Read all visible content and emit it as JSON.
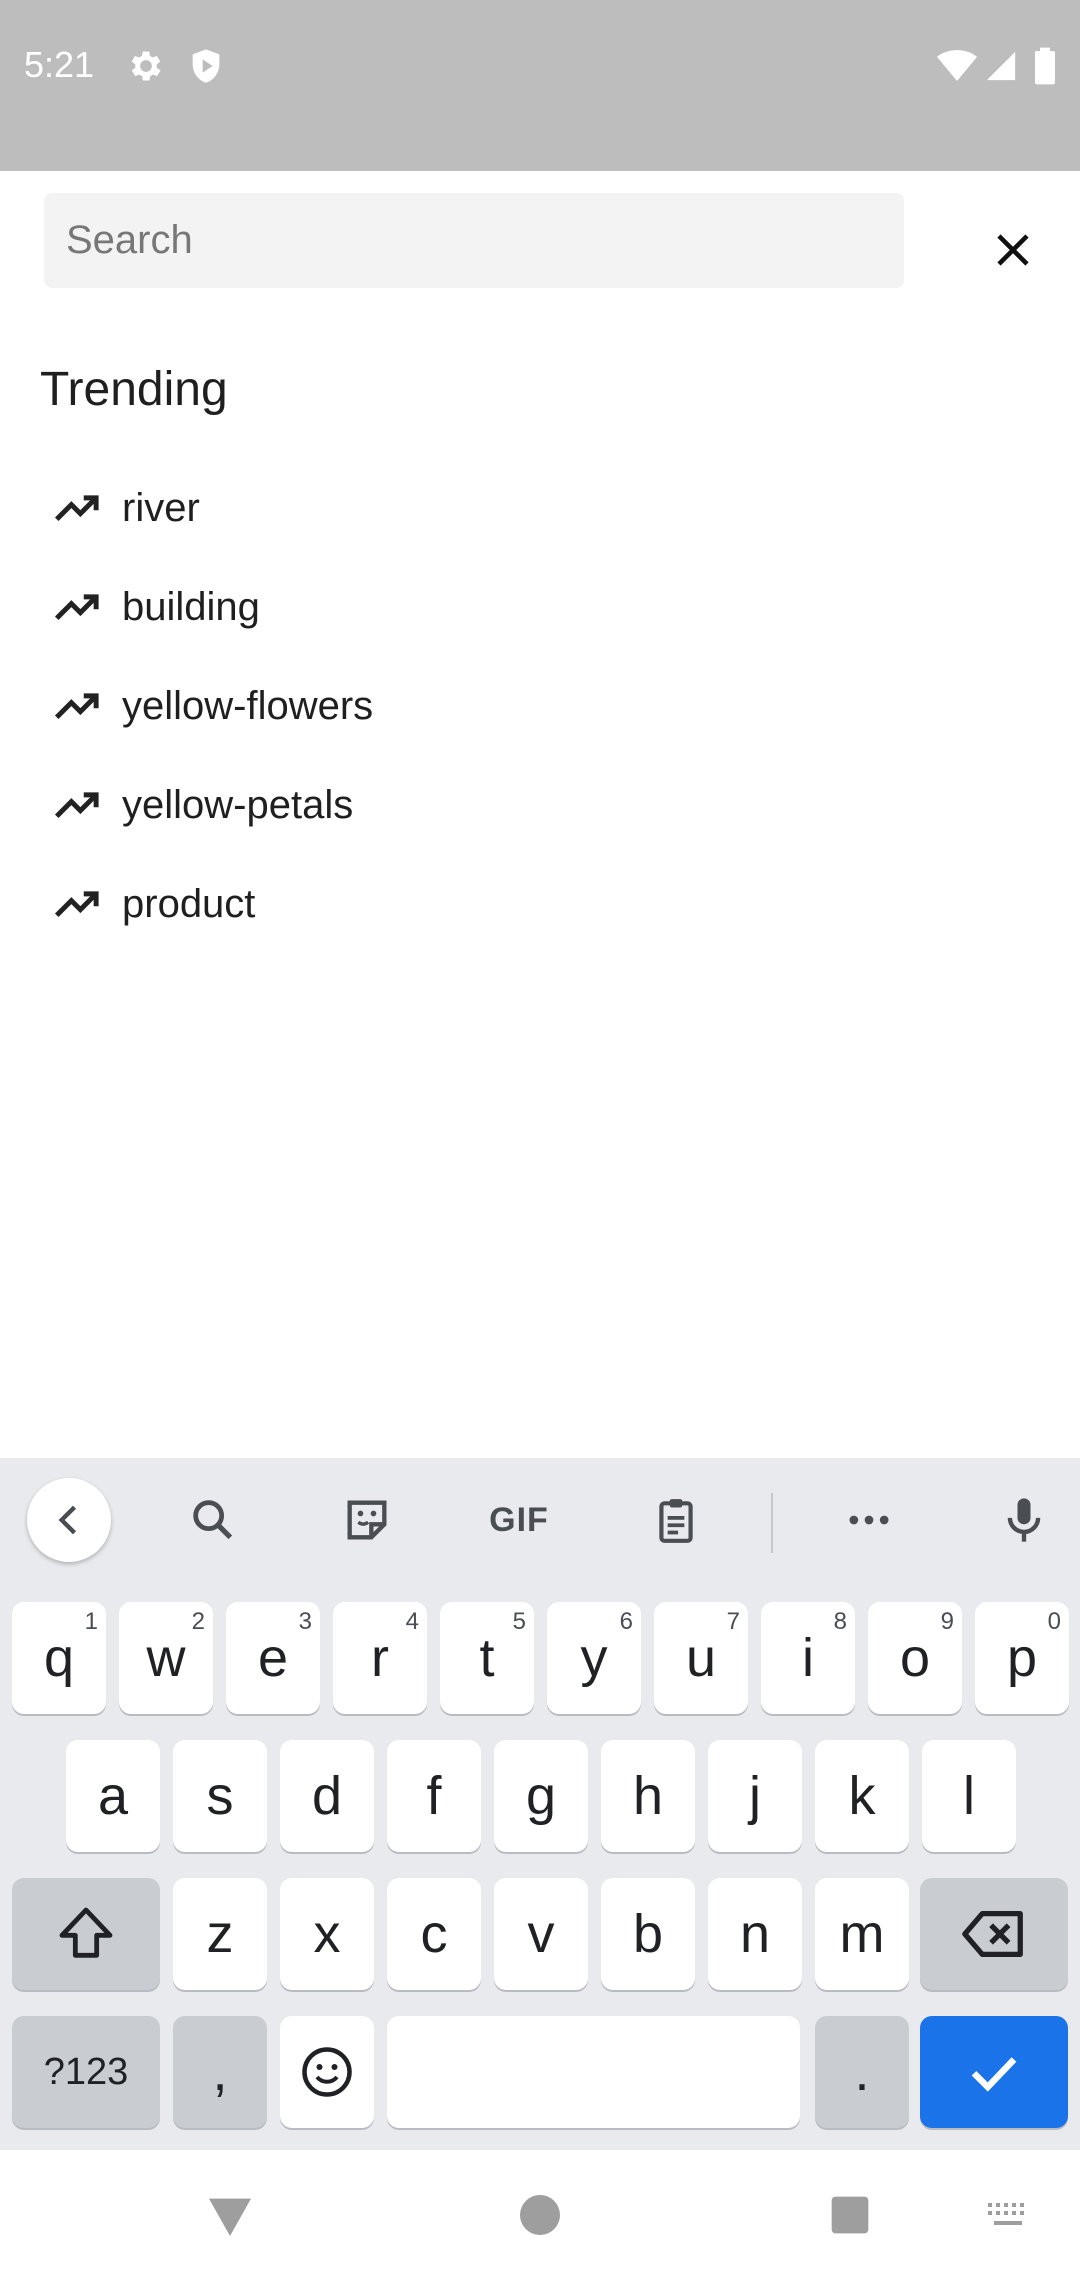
{
  "status_bar": {
    "time": "5:21",
    "icons": [
      "gear-icon",
      "shield-play-icon",
      "wifi-icon",
      "signal-icon",
      "battery-icon"
    ]
  },
  "search": {
    "placeholder": "Search",
    "value": ""
  },
  "trending": {
    "title": "Trending",
    "items": [
      {
        "label": "river"
      },
      {
        "label": "building"
      },
      {
        "label": "yellow-flowers"
      },
      {
        "label": "yellow-petals"
      },
      {
        "label": "product"
      }
    ]
  },
  "keyboard": {
    "toolbar": {
      "gif_label": "GIF",
      "icons": [
        "chevron-left-icon",
        "search-icon",
        "sticker-icon",
        "gif-icon",
        "clipboard-icon",
        "more-horizontal-icon",
        "microphone-icon"
      ]
    },
    "row1": [
      {
        "key": "q",
        "hint": "1"
      },
      {
        "key": "w",
        "hint": "2"
      },
      {
        "key": "e",
        "hint": "3"
      },
      {
        "key": "r",
        "hint": "4"
      },
      {
        "key": "t",
        "hint": "5"
      },
      {
        "key": "y",
        "hint": "6"
      },
      {
        "key": "u",
        "hint": "7"
      },
      {
        "key": "i",
        "hint": "8"
      },
      {
        "key": "o",
        "hint": "9"
      },
      {
        "key": "p",
        "hint": "0"
      }
    ],
    "row2": [
      "a",
      "s",
      "d",
      "f",
      "g",
      "h",
      "j",
      "k",
      "l"
    ],
    "row3": [
      "z",
      "x",
      "c",
      "v",
      "b",
      "n",
      "m"
    ],
    "row4": {
      "symbols": "?123",
      "comma": ",",
      "period": "."
    }
  },
  "colors": {
    "status_bar_bg": "#bdbdbd",
    "keyboard_bg": "#e8eaed",
    "enter_key": "#1a73e8"
  }
}
